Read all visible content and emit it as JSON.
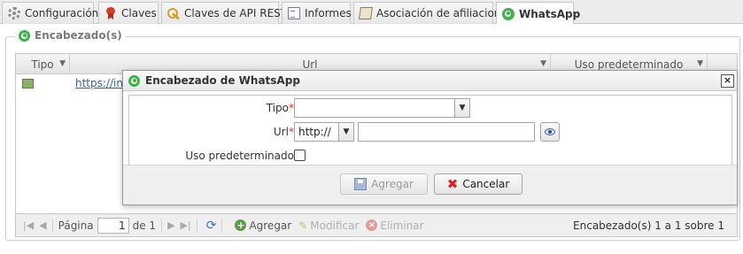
{
  "tabs": [
    {
      "label": "Configuración",
      "icon": "gear-icon"
    },
    {
      "label": "Claves",
      "icon": "ribbon-icon"
    },
    {
      "label": "Claves de API REST",
      "icon": "key-icon"
    },
    {
      "label": "Informes",
      "icon": "report-icon"
    },
    {
      "label": "Asociación de afiliaciones",
      "icon": "book-icon"
    },
    {
      "label": "WhatsApp",
      "icon": "whatsapp-icon",
      "active": true
    }
  ],
  "section": {
    "title": "Encabezado(s)"
  },
  "grid": {
    "columns": [
      "Tipo",
      "Url",
      "Uso predeterminado"
    ],
    "rows": [
      {
        "url": "https://in"
      }
    ]
  },
  "pager": {
    "page_label": "Página",
    "page_value": "1",
    "of_label": "de 1",
    "add_label": "Agregar",
    "edit_label": "Modificar",
    "delete_label": "Eliminar",
    "info": "Encabezado(s) 1 a 1 sobre 1"
  },
  "dialog": {
    "title": "Encabezado de WhatsApp",
    "close": "×",
    "fields": {
      "tipo_label": "Tipo",
      "url_label": "Url",
      "required_mark": "*",
      "colon": ":",
      "protocol_value": "http://",
      "uso_label": "Uso predeterminado:"
    },
    "buttons": {
      "save": "Agregar",
      "cancel": "Cancelar"
    }
  },
  "colors": {
    "accent": "#3cb44a",
    "link": "#3a5fa0",
    "required": "#dd2222"
  }
}
